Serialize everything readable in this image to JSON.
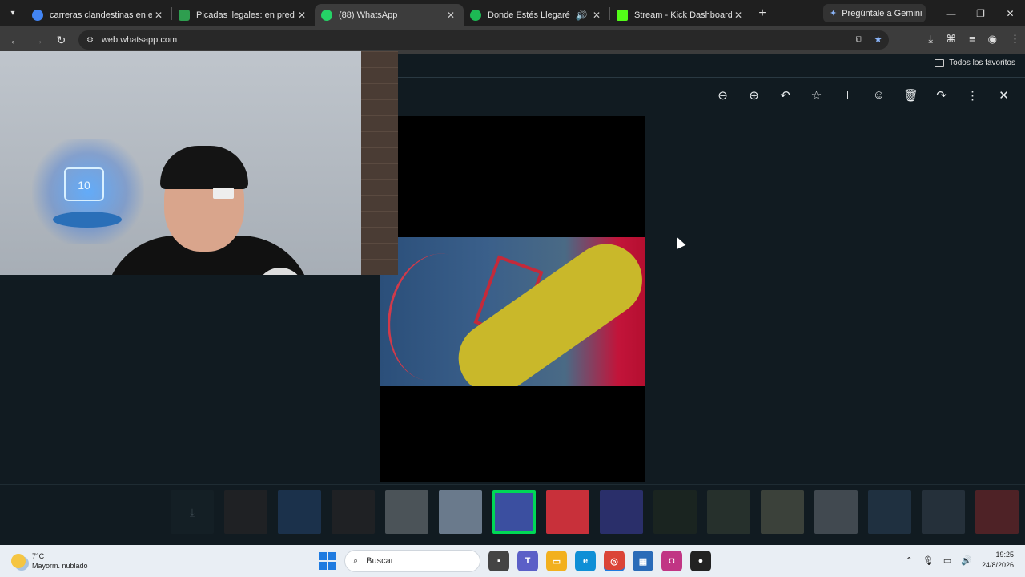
{
  "browser": {
    "tabs": [
      {
        "title": "carreras clandestinas en el jag",
        "favicon_color": "#4285f4",
        "active": false
      },
      {
        "title": "Picadas ilegales: en predio mu",
        "favicon_color": "#2e9e4f",
        "active": false
      },
      {
        "title": "(88) WhatsApp",
        "favicon_color": "#25d366",
        "active": true
      },
      {
        "title": "Donde Estés Llegaré • Ale",
        "favicon_color": "#1db954",
        "active": false
      },
      {
        "title": "Stream - Kick Dashboard",
        "favicon_color": "#53fc18",
        "active": false
      }
    ],
    "new_tab": "+",
    "gemini_label": "Pregúntale a Gemini",
    "url": "web.whatsapp.com",
    "bookmarks_folder": "Todos los favoritos"
  },
  "viewer": {
    "tools": [
      "zoom-out-icon",
      "zoom-in-icon",
      "reply-icon",
      "star-icon",
      "pin-icon",
      "emoji-icon",
      "delete-icon",
      "forward-icon",
      "more-icon",
      "close-icon"
    ]
  },
  "thumbnails": [
    {
      "color": "#1c272d",
      "faded": true,
      "kind": "download"
    },
    {
      "color": "#3a2e2a",
      "faded": true
    },
    {
      "color": "#2d5b9a",
      "faded": true
    },
    {
      "color": "#3a2e2a",
      "faded": true
    },
    {
      "color": "#b8bcc0",
      "faded": true
    },
    {
      "color": "#6a7a8c",
      "faded": false
    },
    {
      "color": "#3b4fa0",
      "faded": false,
      "selected": true
    },
    {
      "color": "#c8303a",
      "faded": false
    },
    {
      "color": "#2a2f6a",
      "faded": false
    },
    {
      "color": "#1a2420",
      "faded": false
    },
    {
      "color": "#26302c",
      "faded": false
    },
    {
      "color": "#8a8a6a",
      "faded": true
    },
    {
      "color": "#9aa0a8",
      "faded": true
    },
    {
      "color": "#3a5a7a",
      "faded": true
    },
    {
      "color": "#4a5a6a",
      "faded": true
    },
    {
      "color": "#c03030",
      "faded": true
    }
  ],
  "taskbar": {
    "weather_temp": "7°C",
    "weather_desc": "Mayorm. nublado",
    "search_placeholder": "Buscar",
    "time": "19:25",
    "date": "24/8/2026"
  }
}
